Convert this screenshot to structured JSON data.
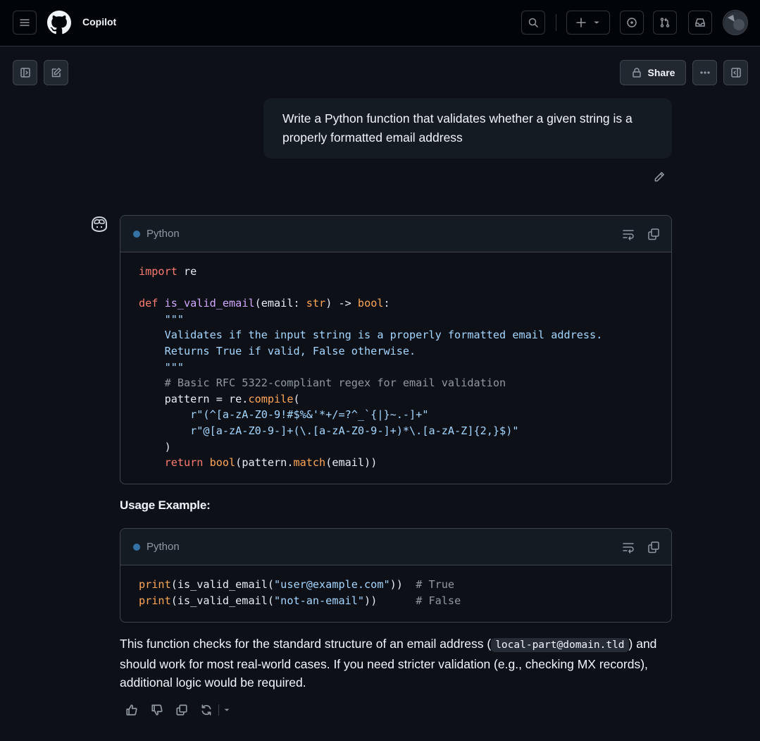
{
  "header": {
    "app_title": "Copilot",
    "icons": [
      "menu-icon",
      "github-logo-icon",
      "search-icon",
      "plus-icon",
      "chevron-down-icon",
      "issue-icon",
      "pull-request-icon",
      "inbox-icon"
    ]
  },
  "toolbar": {
    "share_label": "Share",
    "icons": [
      "sidebar-expand-icon",
      "new-chat-icon",
      "lock-icon",
      "kebab-icon",
      "panel-right-icon"
    ]
  },
  "user_message": {
    "text": "Write a Python function that validates whether a given string is a properly formatted email address"
  },
  "code_blocks": [
    {
      "language": "Python",
      "lines": [
        [
          [
            "kw",
            "import"
          ],
          [
            "pl",
            " re"
          ]
        ],
        [],
        [
          [
            "kw",
            "def"
          ],
          [
            "pl",
            " "
          ],
          [
            "fn",
            "is_valid_email"
          ],
          [
            "pl",
            "(email: "
          ],
          [
            "bi",
            "str"
          ],
          [
            "pl",
            ") -> "
          ],
          [
            "bi",
            "bool"
          ],
          [
            "pl",
            ":"
          ]
        ],
        [
          [
            "str",
            "    \"\"\""
          ]
        ],
        [
          [
            "str",
            "    Validates if the input string is a properly formatted email address."
          ]
        ],
        [
          [
            "str",
            "    Returns True if valid, False otherwise."
          ]
        ],
        [
          [
            "str",
            "    \"\"\""
          ]
        ],
        [
          [
            "cm",
            "    # Basic RFC 5322-compliant regex for email validation"
          ]
        ],
        [
          [
            "pl",
            "    pattern = re."
          ],
          [
            "bi",
            "compile"
          ],
          [
            "pl",
            "("
          ]
        ],
        [
          [
            "str",
            "        r\"(^[a-zA-Z0-9!#$%&'*+/=?^_`{|}~.-]+\""
          ]
        ],
        [
          [
            "str",
            "        r\"@[a-zA-Z0-9-]+(\\.[a-zA-Z0-9-]+)*\\.[a-zA-Z]{2,}$)\""
          ]
        ],
        [
          [
            "pl",
            "    )"
          ]
        ],
        [
          [
            "kw",
            "    return"
          ],
          [
            "pl",
            " "
          ],
          [
            "bi",
            "bool"
          ],
          [
            "pl",
            "(pattern."
          ],
          [
            "bi",
            "match"
          ],
          [
            "pl",
            "(email))"
          ]
        ]
      ]
    },
    {
      "language": "Python",
      "lines": [
        [
          [
            "bi",
            "print"
          ],
          [
            "pl",
            "(is_valid_email("
          ],
          [
            "str",
            "\"user@example.com\""
          ],
          [
            "pl",
            "))  "
          ],
          [
            "cm",
            "# True"
          ]
        ],
        [
          [
            "bi",
            "print"
          ],
          [
            "pl",
            "(is_valid_email("
          ],
          [
            "str",
            "\"not-an-email\""
          ],
          [
            "pl",
            "))      "
          ],
          [
            "cm",
            "# False"
          ]
        ]
      ]
    }
  ],
  "response": {
    "usage_heading": "Usage Example:",
    "para_before": "This function checks for the standard structure of an email address (",
    "inline_code": "local-part@domain.tld",
    "para_after": ") and should work for most real-world cases. If you need stricter validation (e.g., checking MX records), additional logic would be required."
  },
  "feedback_icons": [
    "thumbs-up-icon",
    "thumbs-down-icon",
    "copy-icon",
    "regenerate-icon",
    "chevron-down-icon"
  ]
}
